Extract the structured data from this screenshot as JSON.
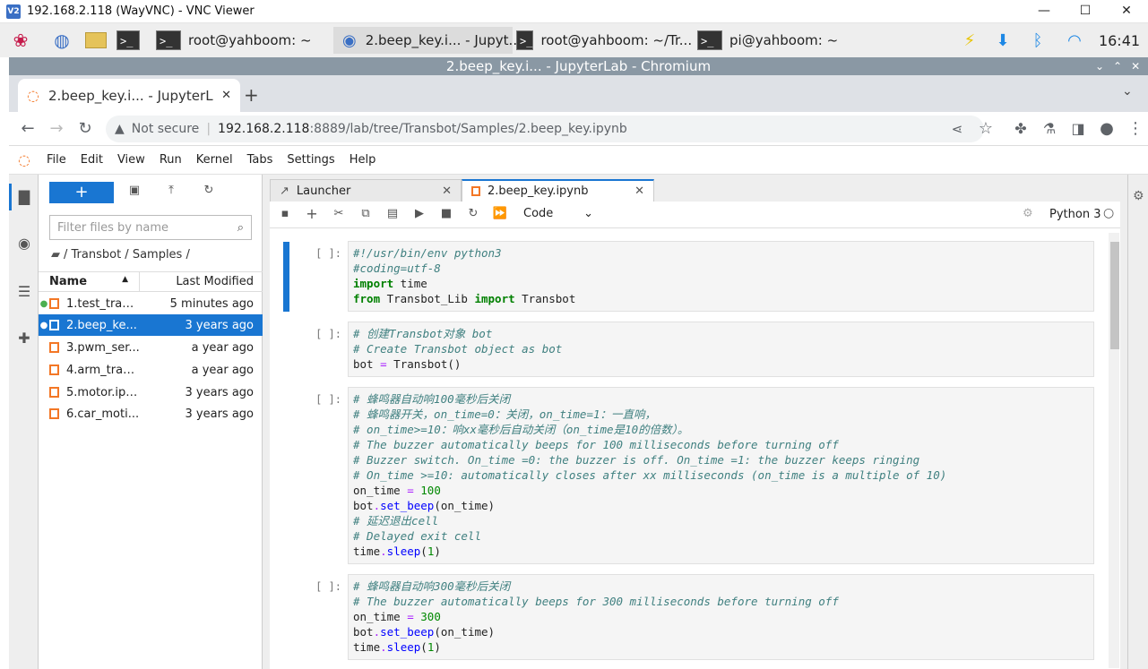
{
  "vnc": {
    "logo": "V2",
    "title": "192.168.2.118 (WayVNC) - VNC Viewer",
    "min": "—",
    "max": "☐",
    "close": "✕"
  },
  "taskbar": {
    "items": [
      {
        "label": "root@yahboom: ~"
      },
      {
        "label": "2.beep_key.i... - Jupyt..."
      },
      {
        "label": "root@yahboom: ~/Tr..."
      },
      {
        "label": "pi@yahboom: ~"
      }
    ],
    "clock": "16:41"
  },
  "chrome": {
    "window_title": "2.beep_key.i... - JupyterLab - Chromium",
    "tab_title": "2.beep_key.i... - JupyterL",
    "security": "Not secure",
    "url_host": "192.168.2.118",
    "url_rest": ":8889/lab/tree/Transbot/Samples/2.beep_key.ipynb"
  },
  "menu": [
    "File",
    "Edit",
    "View",
    "Run",
    "Kernel",
    "Tabs",
    "Settings",
    "Help"
  ],
  "filebrowser": {
    "filter_placeholder": "Filter files by name",
    "breadcrumb": "/ Transbot / Samples /",
    "col_name": "Name",
    "col_modified": "Last Modified",
    "files": [
      {
        "name": "1.test_tran...",
        "modified": "5 minutes ago"
      },
      {
        "name": "2.beep_ke...",
        "modified": "3 years ago"
      },
      {
        "name": "3.pwm_ser...",
        "modified": "a year ago"
      },
      {
        "name": "4.arm_tran...",
        "modified": "a year ago"
      },
      {
        "name": "5.motor.ipy...",
        "modified": "3 years ago"
      },
      {
        "name": "6.car_moti...",
        "modified": "3 years ago"
      }
    ]
  },
  "tabs": {
    "launcher": "Launcher",
    "notebook": "2.beep_key.ipynb"
  },
  "toolbar": {
    "cell_type": "Code",
    "kernel": "Python 3"
  },
  "cells": {
    "prompt": "[ ]:"
  }
}
